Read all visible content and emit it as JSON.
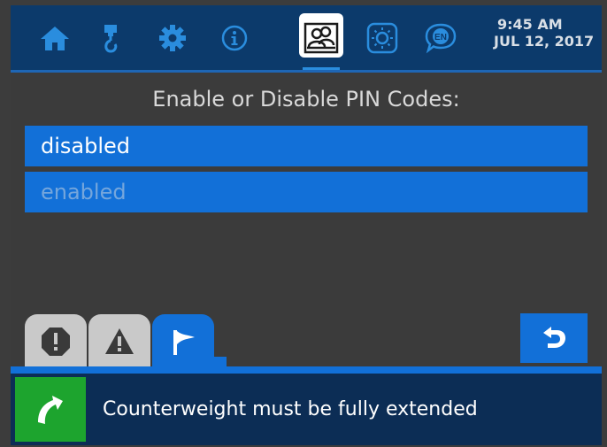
{
  "header": {
    "nav_icons": [
      "home-icon",
      "hook-icon",
      "gear-icon",
      "info-icon",
      "users-icon",
      "brightness-icon",
      "language-icon"
    ],
    "active_icon": "users-icon",
    "language_code": "EN",
    "time": "9:45 AM",
    "date": "JUL 12, 2017"
  },
  "main": {
    "title": "Enable or Disable PIN Codes:",
    "options": [
      {
        "label": "disabled",
        "selected": true
      },
      {
        "label": "enabled",
        "selected": false
      }
    ]
  },
  "tabs": [
    {
      "icon": "alarm-octagon-icon",
      "active": false
    },
    {
      "icon": "warning-triangle-icon",
      "active": false
    },
    {
      "icon": "flag-icon",
      "active": true
    }
  ],
  "status": {
    "icon": "turn-arrow-icon",
    "message": "Counterweight must be fully extended"
  },
  "colors": {
    "header_bg": "#0c3a6b",
    "accent_blue": "#1270d8",
    "panel_bg": "#3b3b3b",
    "status_bg": "#0c2d55",
    "status_green": "#1da42e",
    "inactive_tab": "#c9c9c9"
  }
}
